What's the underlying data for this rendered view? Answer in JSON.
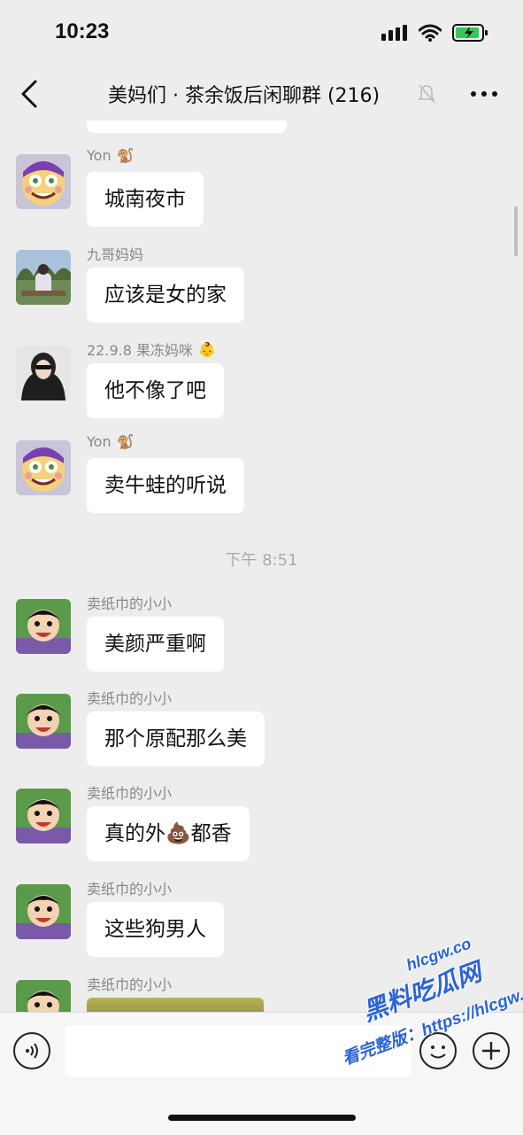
{
  "status_bar": {
    "time": "10:23"
  },
  "header": {
    "title": "美妈们 · 茶余饭后闲聊群 (216)"
  },
  "messages": [
    {
      "sender": "Yon",
      "sender_emoji": "🐒",
      "text": "城南夜市"
    },
    {
      "sender": "九哥妈妈",
      "sender_emoji": "",
      "text": "应该是女的家"
    },
    {
      "sender": "22.9.8 果冻妈咪",
      "sender_emoji": "👶",
      "text": "他不像了吧"
    },
    {
      "sender": "Yon",
      "sender_emoji": "🐒",
      "text": "卖牛蛙的听说"
    }
  ],
  "time_separator": "下午 8:51",
  "messages2": [
    {
      "sender": "卖纸巾的小小",
      "text": "美颜严重啊"
    },
    {
      "sender": "卖纸巾的小小",
      "text": "那个原配那么美"
    },
    {
      "sender": "卖纸巾的小小",
      "text": "真的外💩都香"
    },
    {
      "sender": "卖纸巾的小小",
      "text": "这些狗男人"
    },
    {
      "sender": "卖纸巾的小小",
      "text": ""
    }
  ],
  "watermark": {
    "brand": "黑料吃瓜网",
    "url_top": "hlcgw.co",
    "line2": "看完整版：https://hlcgw.co"
  }
}
